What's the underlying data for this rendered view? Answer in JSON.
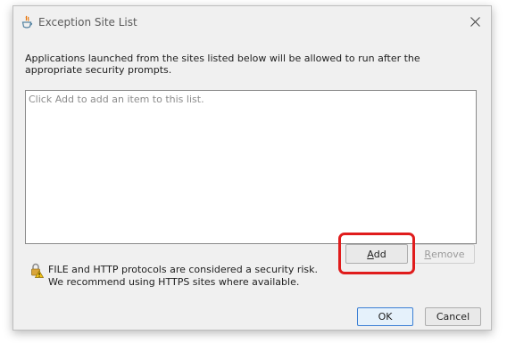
{
  "window": {
    "title": "Exception Site List",
    "icon": "java-icon",
    "close_icon": "close-icon"
  },
  "description": "Applications launched from the sites listed below will be allowed to run after the appropriate security prompts.",
  "list": {
    "placeholder": "Click Add to add an item to this list.",
    "items": []
  },
  "buttons": {
    "add_mnemonic": "A",
    "add_rest": "dd",
    "remove_mnemonic": "R",
    "remove_rest": "emove",
    "ok": "OK",
    "cancel": "Cancel"
  },
  "warning": {
    "icon": "lock-warning-icon",
    "line1": "FILE and HTTP protocols are considered a security risk.",
    "line2": "We recommend using HTTPS sites where available."
  },
  "annotation": {
    "color": "#e01c1c",
    "target": "Add"
  }
}
